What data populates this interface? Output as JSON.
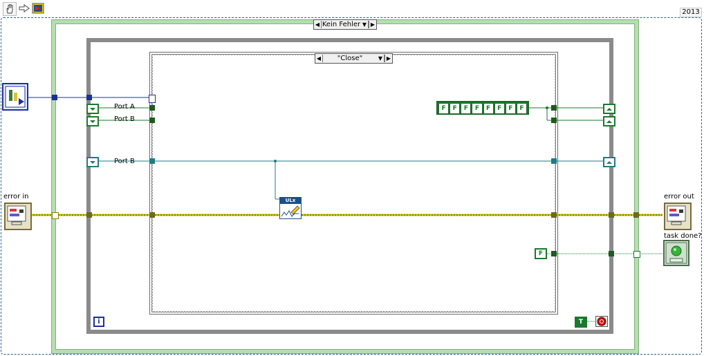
{
  "toolbar": {
    "icons": [
      "hand-icon",
      "arrow-icon",
      "vi-icon"
    ]
  },
  "year": "2013",
  "outer_case": {
    "selector": "Kein Fehler"
  },
  "inner_case": {
    "selector": "\"Close\""
  },
  "port_refs": {
    "port_a_label": "Port A",
    "port_b1_label": "Port B",
    "port_b2_label": "Port B"
  },
  "bool_array": [
    "F",
    "F",
    "F",
    "F",
    "F",
    "F",
    "F",
    "F"
  ],
  "false_const": "F",
  "true_const": "T",
  "iteration": "i",
  "ulx_node": {
    "label": "ULx"
  },
  "terminals": {
    "error_in": "error in",
    "error_out": "error out",
    "task_done": "task done?"
  },
  "colors": {
    "boolean_green": "#1a7a2b",
    "error_cluster_yellow": "#c8c200",
    "numeric_blue": "#1b2fa0",
    "refnum_teal": "#1e7b84",
    "case_border_green": "#b7ddb0"
  }
}
